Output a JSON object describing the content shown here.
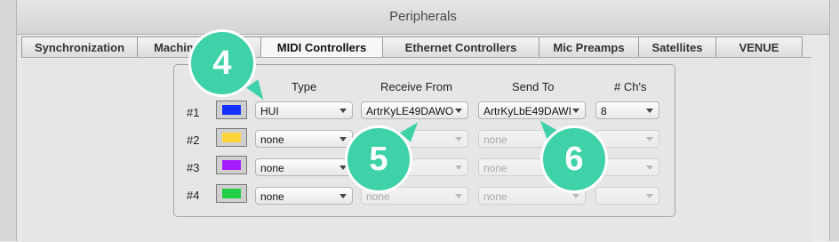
{
  "window": {
    "title": "Peripherals"
  },
  "tabs": [
    {
      "label": "Synchronization"
    },
    {
      "label": "Machine Control"
    },
    {
      "label": "MIDI Controllers"
    },
    {
      "label": "Ethernet Controllers"
    },
    {
      "label": "Mic Preamps"
    },
    {
      "label": "Satellites"
    },
    {
      "label": "VENUE"
    }
  ],
  "active_tab": "MIDI Controllers",
  "columns": {
    "type": "Type",
    "receive": "Receive From",
    "send": "Send To",
    "channels": "# Ch's"
  },
  "rows": [
    {
      "label": "#1",
      "color": "#1430ff",
      "type": "HUI",
      "receive": "ArtrKyLE49DAWO",
      "send": "ArtrKyLbE49DAWI",
      "channels": "8",
      "enabled": true
    },
    {
      "label": "#2",
      "color": "#ffd43b",
      "type": "none",
      "receive": "",
      "send": "none",
      "channels": "",
      "enabled": false
    },
    {
      "label": "#3",
      "color": "#a51dff",
      "type": "none",
      "receive": "",
      "send": "none",
      "channels": "",
      "enabled": false
    },
    {
      "label": "#4",
      "color": "#20cf45",
      "type": "none",
      "receive": "none",
      "send": "none",
      "channels": "",
      "enabled": false
    }
  ],
  "callouts": [
    {
      "label": "4"
    },
    {
      "label": "5"
    },
    {
      "label": "6"
    }
  ],
  "accent": "#3fd2a8"
}
